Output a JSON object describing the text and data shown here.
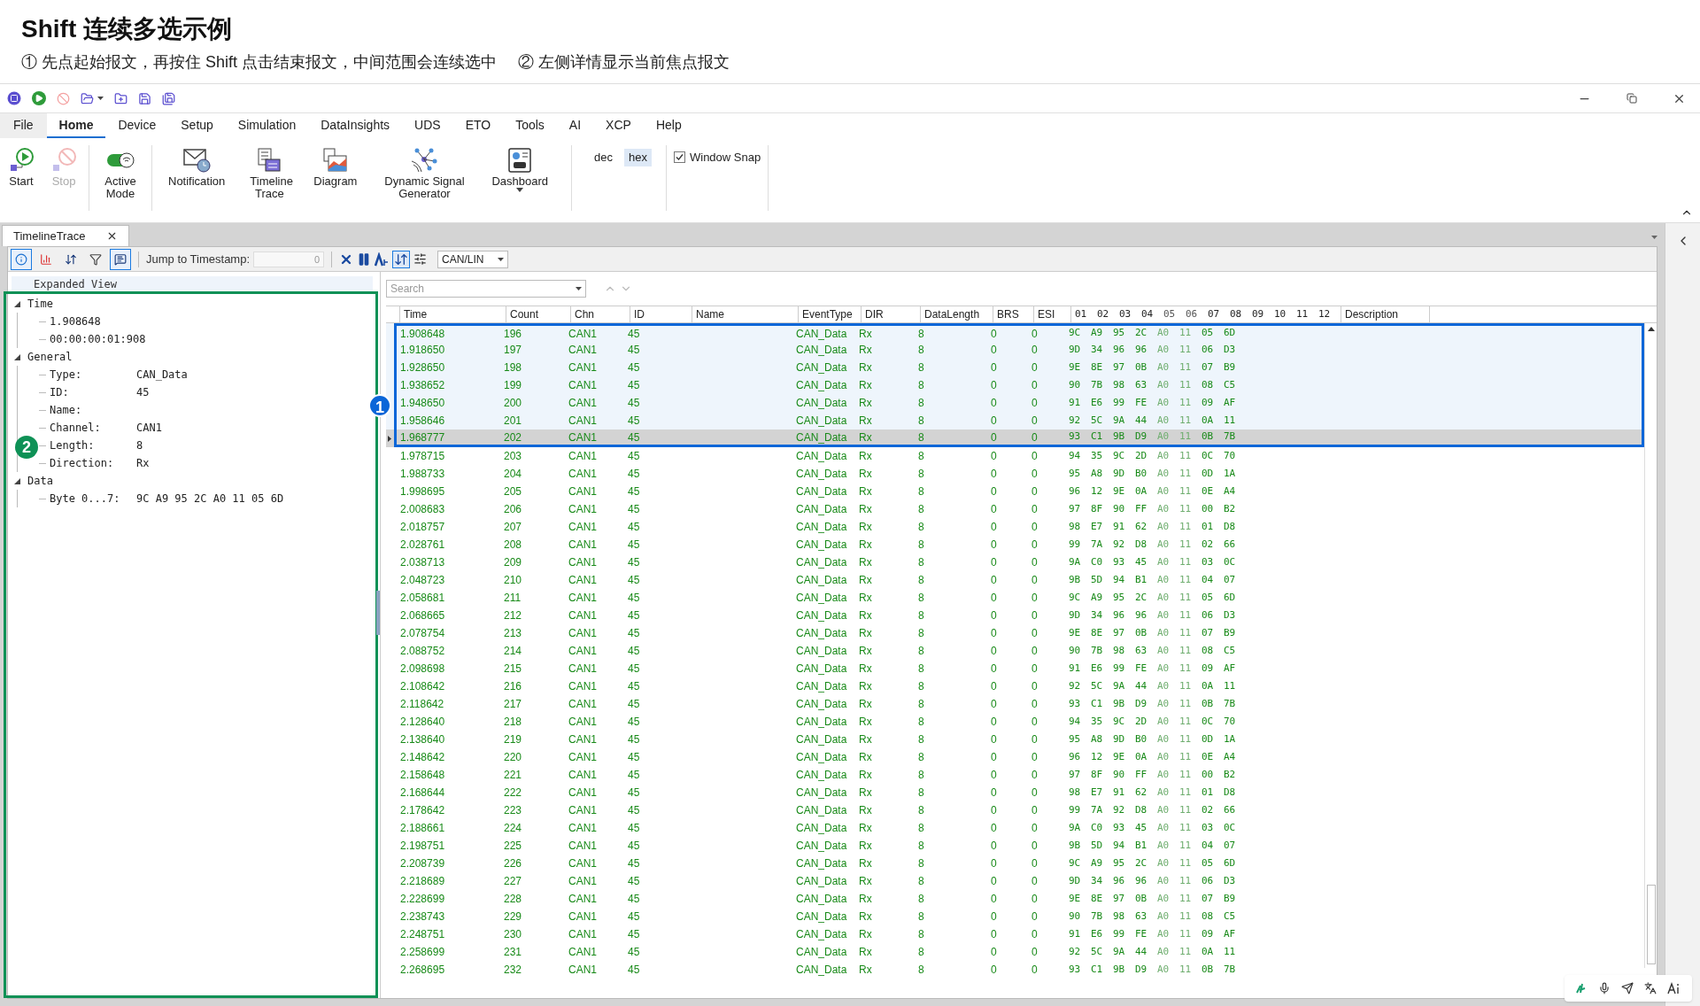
{
  "heading": {
    "title": "Shift 连续多选示例",
    "notes": [
      "① 先点起始报文，再按住 Shift 点击结束报文，中间范围会连续选中",
      "② 左侧详情显示当前焦点报文"
    ]
  },
  "menu": [
    {
      "label": "File",
      "selected": false,
      "kind": "file"
    },
    {
      "label": "Home",
      "selected": true
    },
    {
      "label": "Device",
      "selected": false
    },
    {
      "label": "Setup",
      "selected": false
    },
    {
      "label": "Simulation",
      "selected": false
    },
    {
      "label": "DataInsights",
      "selected": false
    },
    {
      "label": "UDS",
      "selected": false
    },
    {
      "label": "ETO",
      "selected": false
    },
    {
      "label": "Tools",
      "selected": false
    },
    {
      "label": "AI",
      "selected": false
    },
    {
      "label": "XCP",
      "selected": false
    },
    {
      "label": "Help",
      "selected": false
    }
  ],
  "ribbon": {
    "buttons": [
      {
        "kind": "start",
        "label": "Start",
        "disabled": false
      },
      {
        "kind": "stop",
        "label": "Stop",
        "disabled": true
      },
      {
        "kind": "mode",
        "label": "Active Mode",
        "disabled": false
      },
      {
        "kind": "notification",
        "label": "Notification",
        "disabled": false
      },
      {
        "kind": "timeline",
        "label": "Timeline Trace",
        "disabled": false
      },
      {
        "kind": "diagram",
        "label": "Diagram",
        "disabled": false
      },
      {
        "kind": "signal",
        "label": "Dynamic Signal Generator",
        "disabled": false
      },
      {
        "kind": "dashboard",
        "label": "Dashboard",
        "disabled": false
      }
    ],
    "formats": [
      {
        "label": "dec",
        "selected": false
      },
      {
        "label": "hex",
        "selected": true
      }
    ],
    "window_snap": {
      "label": "Window Snap",
      "checked": true
    }
  },
  "document_tab": {
    "label": "TimelineTrace"
  },
  "toolbar": {
    "toggles": [
      {
        "kind": "info",
        "selected": true
      },
      {
        "kind": "chart",
        "selected": false
      },
      {
        "kind": "fit",
        "selected": false
      },
      {
        "kind": "filter",
        "selected": false
      },
      {
        "kind": "detail",
        "selected": true
      }
    ],
    "jump_label": "Jump to Timestamp:",
    "jump_value": "0",
    "bus": "CAN/LIN"
  },
  "detail_tree": {
    "header": "Expanded View",
    "nodes": [
      {
        "label": "Time",
        "expanded": true,
        "children": [
          {
            "label": "1.908648"
          },
          {
            "label": "00:00:00:01:908"
          }
        ]
      },
      {
        "label": "General",
        "expanded": true,
        "children": [
          {
            "label": "Type:",
            "value": "CAN_Data"
          },
          {
            "label": "ID:",
            "value": "45"
          },
          {
            "label": "Name:"
          },
          {
            "label": "Channel:",
            "value": "CAN1"
          },
          {
            "label": "Length:",
            "value": "8"
          },
          {
            "label": "Direction:",
            "value": "Rx"
          }
        ]
      },
      {
        "label": "Data",
        "expanded": true,
        "children": [
          {
            "label": "Byte 0...7:",
            "value": "9C A9 95 2C A0 11 05 6D"
          }
        ]
      }
    ]
  },
  "search": {
    "placeholder": "Search"
  },
  "table": {
    "columns": [
      "Time",
      "Count",
      "Chn",
      "ID",
      "Name",
      "EventType",
      "DIR",
      "DataLength",
      "BRS",
      "ESI"
    ],
    "byte_columns": [
      {
        "label": "01",
        "dimmed": false
      },
      {
        "label": "02",
        "dimmed": false
      },
      {
        "label": "03",
        "dimmed": false
      },
      {
        "label": "04",
        "dimmed": false
      },
      {
        "label": "05",
        "dimmed": true
      },
      {
        "label": "06",
        "dimmed": true
      },
      {
        "label": "07",
        "dimmed": false
      },
      {
        "label": "08",
        "dimmed": false
      },
      {
        "label": "09",
        "dimmed": false
      },
      {
        "label": "10",
        "dimmed": false
      },
      {
        "label": "11",
        "dimmed": false
      },
      {
        "label": "12",
        "dimmed": false
      }
    ],
    "last_column": "Description",
    "rows": [
      {
        "time": "1.908648",
        "count": "196",
        "chn": "CAN1",
        "id": "45",
        "type": "CAN_Data",
        "dir": "Rx",
        "len": "8",
        "brs": "0",
        "esi": "0",
        "bytes": [
          "9C",
          "A9",
          "95",
          "2C",
          "A0",
          "11",
          "05",
          "6D"
        ],
        "selected": true,
        "focused": false
      },
      {
        "time": "1.918650",
        "count": "197",
        "chn": "CAN1",
        "id": "45",
        "type": "CAN_Data",
        "dir": "Rx",
        "len": "8",
        "brs": "0",
        "esi": "0",
        "bytes": [
          "9D",
          "34",
          "96",
          "96",
          "A0",
          "11",
          "06",
          "D3"
        ],
        "selected": true,
        "focused": false
      },
      {
        "time": "1.928650",
        "count": "198",
        "chn": "CAN1",
        "id": "45",
        "type": "CAN_Data",
        "dir": "Rx",
        "len": "8",
        "brs": "0",
        "esi": "0",
        "bytes": [
          "9E",
          "8E",
          "97",
          "0B",
          "A0",
          "11",
          "07",
          "B9"
        ],
        "selected": true,
        "focused": false
      },
      {
        "time": "1.938652",
        "count": "199",
        "chn": "CAN1",
        "id": "45",
        "type": "CAN_Data",
        "dir": "Rx",
        "len": "8",
        "brs": "0",
        "esi": "0",
        "bytes": [
          "90",
          "7B",
          "98",
          "63",
          "A0",
          "11",
          "08",
          "C5"
        ],
        "selected": true,
        "focused": false
      },
      {
        "time": "1.948650",
        "count": "200",
        "chn": "CAN1",
        "id": "45",
        "type": "CAN_Data",
        "dir": "Rx",
        "len": "8",
        "brs": "0",
        "esi": "0",
        "bytes": [
          "91",
          "E6",
          "99",
          "FE",
          "A0",
          "11",
          "09",
          "AF"
        ],
        "selected": true,
        "focused": false
      },
      {
        "time": "1.958646",
        "count": "201",
        "chn": "CAN1",
        "id": "45",
        "type": "CAN_Data",
        "dir": "Rx",
        "len": "8",
        "brs": "0",
        "esi": "0",
        "bytes": [
          "92",
          "5C",
          "9A",
          "44",
          "A0",
          "11",
          "0A",
          "11"
        ],
        "selected": true,
        "focused": false
      },
      {
        "time": "1.968777",
        "count": "202",
        "chn": "CAN1",
        "id": "45",
        "type": "CAN_Data",
        "dir": "Rx",
        "len": "8",
        "brs": "0",
        "esi": "0",
        "bytes": [
          "93",
          "C1",
          "9B",
          "D9",
          "A0",
          "11",
          "0B",
          "7B"
        ],
        "selected": true,
        "focused": true
      },
      {
        "time": "1.978715",
        "count": "203",
        "chn": "CAN1",
        "id": "45",
        "type": "CAN_Data",
        "dir": "Rx",
        "len": "8",
        "brs": "0",
        "esi": "0",
        "bytes": [
          "94",
          "35",
          "9C",
          "2D",
          "A0",
          "11",
          "0C",
          "70"
        ],
        "selected": false,
        "focused": false
      },
      {
        "time": "1.988733",
        "count": "204",
        "chn": "CAN1",
        "id": "45",
        "type": "CAN_Data",
        "dir": "Rx",
        "len": "8",
        "brs": "0",
        "esi": "0",
        "bytes": [
          "95",
          "A8",
          "9D",
          "B0",
          "A0",
          "11",
          "0D",
          "1A"
        ],
        "selected": false,
        "focused": false
      },
      {
        "time": "1.998695",
        "count": "205",
        "chn": "CAN1",
        "id": "45",
        "type": "CAN_Data",
        "dir": "Rx",
        "len": "8",
        "brs": "0",
        "esi": "0",
        "bytes": [
          "96",
          "12",
          "9E",
          "0A",
          "A0",
          "11",
          "0E",
          "A4"
        ],
        "selected": false,
        "focused": false
      },
      {
        "time": "2.008683",
        "count": "206",
        "chn": "CAN1",
        "id": "45",
        "type": "CAN_Data",
        "dir": "Rx",
        "len": "8",
        "brs": "0",
        "esi": "0",
        "bytes": [
          "97",
          "8F",
          "90",
          "FF",
          "A0",
          "11",
          "00",
          "B2"
        ],
        "selected": false,
        "focused": false
      },
      {
        "time": "2.018757",
        "count": "207",
        "chn": "CAN1",
        "id": "45",
        "type": "CAN_Data",
        "dir": "Rx",
        "len": "8",
        "brs": "0",
        "esi": "0",
        "bytes": [
          "98",
          "E7",
          "91",
          "62",
          "A0",
          "11",
          "01",
          "D8"
        ],
        "selected": false,
        "focused": false
      },
      {
        "time": "2.028761",
        "count": "208",
        "chn": "CAN1",
        "id": "45",
        "type": "CAN_Data",
        "dir": "Rx",
        "len": "8",
        "brs": "0",
        "esi": "0",
        "bytes": [
          "99",
          "7A",
          "92",
          "D8",
          "A0",
          "11",
          "02",
          "66"
        ],
        "selected": false,
        "focused": false
      },
      {
        "time": "2.038713",
        "count": "209",
        "chn": "CAN1",
        "id": "45",
        "type": "CAN_Data",
        "dir": "Rx",
        "len": "8",
        "brs": "0",
        "esi": "0",
        "bytes": [
          "9A",
          "C0",
          "93",
          "45",
          "A0",
          "11",
          "03",
          "0C"
        ],
        "selected": false,
        "focused": false
      },
      {
        "time": "2.048723",
        "count": "210",
        "chn": "CAN1",
        "id": "45",
        "type": "CAN_Data",
        "dir": "Rx",
        "len": "8",
        "brs": "0",
        "esi": "0",
        "bytes": [
          "9B",
          "5D",
          "94",
          "B1",
          "A0",
          "11",
          "04",
          "07"
        ],
        "selected": false,
        "focused": false
      },
      {
        "time": "2.058681",
        "count": "211",
        "chn": "CAN1",
        "id": "45",
        "type": "CAN_Data",
        "dir": "Rx",
        "len": "8",
        "brs": "0",
        "esi": "0",
        "bytes": [
          "9C",
          "A9",
          "95",
          "2C",
          "A0",
          "11",
          "05",
          "6D"
        ],
        "selected": false,
        "focused": false
      },
      {
        "time": "2.068665",
        "count": "212",
        "chn": "CAN1",
        "id": "45",
        "type": "CAN_Data",
        "dir": "Rx",
        "len": "8",
        "brs": "0",
        "esi": "0",
        "bytes": [
          "9D",
          "34",
          "96",
          "96",
          "A0",
          "11",
          "06",
          "D3"
        ],
        "selected": false,
        "focused": false
      },
      {
        "time": "2.078754",
        "count": "213",
        "chn": "CAN1",
        "id": "45",
        "type": "CAN_Data",
        "dir": "Rx",
        "len": "8",
        "brs": "0",
        "esi": "0",
        "bytes": [
          "9E",
          "8E",
          "97",
          "0B",
          "A0",
          "11",
          "07",
          "B9"
        ],
        "selected": false,
        "focused": false
      },
      {
        "time": "2.088752",
        "count": "214",
        "chn": "CAN1",
        "id": "45",
        "type": "CAN_Data",
        "dir": "Rx",
        "len": "8",
        "brs": "0",
        "esi": "0",
        "bytes": [
          "90",
          "7B",
          "98",
          "63",
          "A0",
          "11",
          "08",
          "C5"
        ],
        "selected": false,
        "focused": false
      },
      {
        "time": "2.098698",
        "count": "215",
        "chn": "CAN1",
        "id": "45",
        "type": "CAN_Data",
        "dir": "Rx",
        "len": "8",
        "brs": "0",
        "esi": "0",
        "bytes": [
          "91",
          "E6",
          "99",
          "FE",
          "A0",
          "11",
          "09",
          "AF"
        ],
        "selected": false,
        "focused": false
      },
      {
        "time": "2.108642",
        "count": "216",
        "chn": "CAN1",
        "id": "45",
        "type": "CAN_Data",
        "dir": "Rx",
        "len": "8",
        "brs": "0",
        "esi": "0",
        "bytes": [
          "92",
          "5C",
          "9A",
          "44",
          "A0",
          "11",
          "0A",
          "11"
        ],
        "selected": false,
        "focused": false
      },
      {
        "time": "2.118642",
        "count": "217",
        "chn": "CAN1",
        "id": "45",
        "type": "CAN_Data",
        "dir": "Rx",
        "len": "8",
        "brs": "0",
        "esi": "0",
        "bytes": [
          "93",
          "C1",
          "9B",
          "D9",
          "A0",
          "11",
          "0B",
          "7B"
        ],
        "selected": false,
        "focused": false
      },
      {
        "time": "2.128640",
        "count": "218",
        "chn": "CAN1",
        "id": "45",
        "type": "CAN_Data",
        "dir": "Rx",
        "len": "8",
        "brs": "0",
        "esi": "0",
        "bytes": [
          "94",
          "35",
          "9C",
          "2D",
          "A0",
          "11",
          "0C",
          "70"
        ],
        "selected": false,
        "focused": false
      },
      {
        "time": "2.138640",
        "count": "219",
        "chn": "CAN1",
        "id": "45",
        "type": "CAN_Data",
        "dir": "Rx",
        "len": "8",
        "brs": "0",
        "esi": "0",
        "bytes": [
          "95",
          "A8",
          "9D",
          "B0",
          "A0",
          "11",
          "0D",
          "1A"
        ],
        "selected": false,
        "focused": false
      },
      {
        "time": "2.148642",
        "count": "220",
        "chn": "CAN1",
        "id": "45",
        "type": "CAN_Data",
        "dir": "Rx",
        "len": "8",
        "brs": "0",
        "esi": "0",
        "bytes": [
          "96",
          "12",
          "9E",
          "0A",
          "A0",
          "11",
          "0E",
          "A4"
        ],
        "selected": false,
        "focused": false
      },
      {
        "time": "2.158648",
        "count": "221",
        "chn": "CAN1",
        "id": "45",
        "type": "CAN_Data",
        "dir": "Rx",
        "len": "8",
        "brs": "0",
        "esi": "0",
        "bytes": [
          "97",
          "8F",
          "90",
          "FF",
          "A0",
          "11",
          "00",
          "B2"
        ],
        "selected": false,
        "focused": false
      },
      {
        "time": "2.168644",
        "count": "222",
        "chn": "CAN1",
        "id": "45",
        "type": "CAN_Data",
        "dir": "Rx",
        "len": "8",
        "brs": "0",
        "esi": "0",
        "bytes": [
          "98",
          "E7",
          "91",
          "62",
          "A0",
          "11",
          "01",
          "D8"
        ],
        "selected": false,
        "focused": false
      },
      {
        "time": "2.178642",
        "count": "223",
        "chn": "CAN1",
        "id": "45",
        "type": "CAN_Data",
        "dir": "Rx",
        "len": "8",
        "brs": "0",
        "esi": "0",
        "bytes": [
          "99",
          "7A",
          "92",
          "D8",
          "A0",
          "11",
          "02",
          "66"
        ],
        "selected": false,
        "focused": false
      },
      {
        "time": "2.188661",
        "count": "224",
        "chn": "CAN1",
        "id": "45",
        "type": "CAN_Data",
        "dir": "Rx",
        "len": "8",
        "brs": "0",
        "esi": "0",
        "bytes": [
          "9A",
          "C0",
          "93",
          "45",
          "A0",
          "11",
          "03",
          "0C"
        ],
        "selected": false,
        "focused": false
      },
      {
        "time": "2.198751",
        "count": "225",
        "chn": "CAN1",
        "id": "45",
        "type": "CAN_Data",
        "dir": "Rx",
        "len": "8",
        "brs": "0",
        "esi": "0",
        "bytes": [
          "9B",
          "5D",
          "94",
          "B1",
          "A0",
          "11",
          "04",
          "07"
        ],
        "selected": false,
        "focused": false
      },
      {
        "time": "2.208739",
        "count": "226",
        "chn": "CAN1",
        "id": "45",
        "type": "CAN_Data",
        "dir": "Rx",
        "len": "8",
        "brs": "0",
        "esi": "0",
        "bytes": [
          "9C",
          "A9",
          "95",
          "2C",
          "A0",
          "11",
          "05",
          "6D"
        ],
        "selected": false,
        "focused": false
      },
      {
        "time": "2.218689",
        "count": "227",
        "chn": "CAN1",
        "id": "45",
        "type": "CAN_Data",
        "dir": "Rx",
        "len": "8",
        "brs": "0",
        "esi": "0",
        "bytes": [
          "9D",
          "34",
          "96",
          "96",
          "A0",
          "11",
          "06",
          "D3"
        ],
        "selected": false,
        "focused": false
      },
      {
        "time": "2.228699",
        "count": "228",
        "chn": "CAN1",
        "id": "45",
        "type": "CAN_Data",
        "dir": "Rx",
        "len": "8",
        "brs": "0",
        "esi": "0",
        "bytes": [
          "9E",
          "8E",
          "97",
          "0B",
          "A0",
          "11",
          "07",
          "B9"
        ],
        "selected": false,
        "focused": false
      },
      {
        "time": "2.238743",
        "count": "229",
        "chn": "CAN1",
        "id": "45",
        "type": "CAN_Data",
        "dir": "Rx",
        "len": "8",
        "brs": "0",
        "esi": "0",
        "bytes": [
          "90",
          "7B",
          "98",
          "63",
          "A0",
          "11",
          "08",
          "C5"
        ],
        "selected": false,
        "focused": false
      },
      {
        "time": "2.248751",
        "count": "230",
        "chn": "CAN1",
        "id": "45",
        "type": "CAN_Data",
        "dir": "Rx",
        "len": "8",
        "brs": "0",
        "esi": "0",
        "bytes": [
          "91",
          "E6",
          "99",
          "FE",
          "A0",
          "11",
          "09",
          "AF"
        ],
        "selected": false,
        "focused": false
      },
      {
        "time": "2.258699",
        "count": "231",
        "chn": "CAN1",
        "id": "45",
        "type": "CAN_Data",
        "dir": "Rx",
        "len": "8",
        "brs": "0",
        "esi": "0",
        "bytes": [
          "92",
          "5C",
          "9A",
          "44",
          "A0",
          "11",
          "0A",
          "11"
        ],
        "selected": false,
        "focused": false
      },
      {
        "time": "2.268695",
        "count": "232",
        "chn": "CAN1",
        "id": "45",
        "type": "CAN_Data",
        "dir": "Rx",
        "len": "8",
        "brs": "0",
        "esi": "0",
        "bytes": [
          "93",
          "C1",
          "9B",
          "D9",
          "A0",
          "11",
          "0B",
          "7B"
        ],
        "selected": false,
        "focused": false
      }
    ]
  },
  "markers": [
    {
      "label": "1",
      "color": "#0b66d8"
    },
    {
      "label": "2",
      "color": "#0e9156"
    }
  ]
}
